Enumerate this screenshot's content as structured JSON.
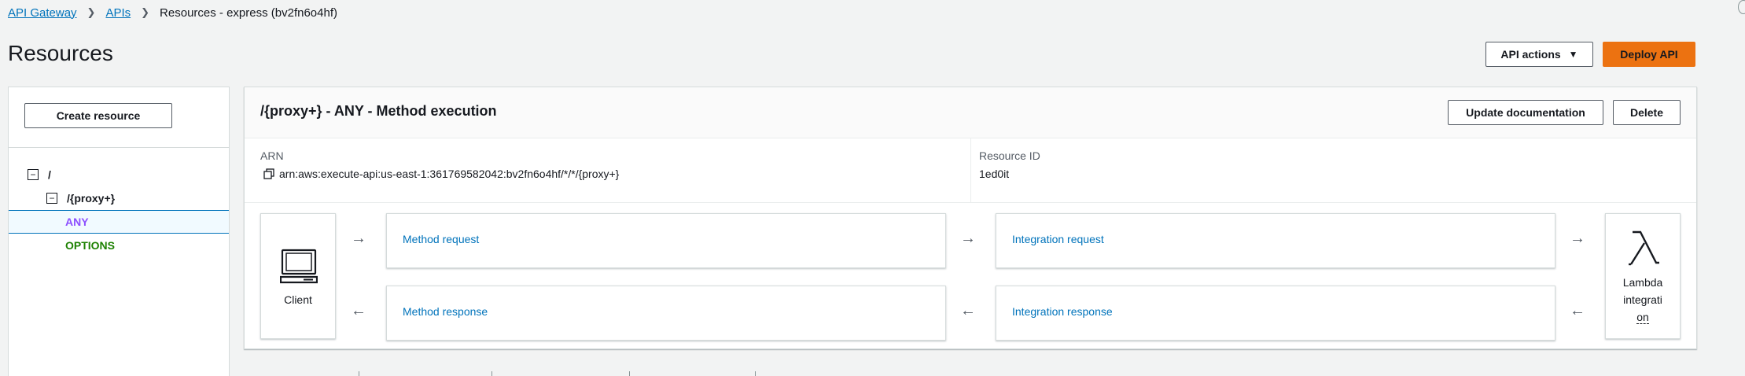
{
  "breadcrumb": {
    "items": [
      "API Gateway",
      "APIs"
    ],
    "current": "Resources - express (bv2fn6o4hf)"
  },
  "page": {
    "title": "Resources"
  },
  "header_actions": {
    "api_actions": "API actions",
    "deploy": "Deploy API"
  },
  "left_panel": {
    "create_resource": "Create resource",
    "tree": [
      {
        "path": "/",
        "toggle": "−"
      },
      {
        "path": "/{proxy+}",
        "toggle": "−"
      }
    ],
    "methods": [
      "ANY",
      "OPTIONS"
    ],
    "selected_method": "ANY"
  },
  "main_panel": {
    "title": "/{proxy+} - ANY - Method execution",
    "update_doc": "Update documentation",
    "delete": "Delete",
    "arn_label": "ARN",
    "arn_value": "arn:aws:execute-api:us-east-1:361769582042:bv2fn6o4hf/*/*/{proxy+}",
    "resource_id_label": "Resource ID",
    "resource_id_value": "1ed0it"
  },
  "flow": {
    "client_label": "Client",
    "method_request": "Method request",
    "method_response": "Method response",
    "integration_request": "Integration request",
    "integration_response": "Integration response",
    "lambda_line1": "Lambda",
    "lambda_line2": "integrati",
    "lambda_line3": "on",
    "arrow_right": "→",
    "arrow_left": "←"
  },
  "colors": {
    "link": "#0073bb",
    "primary_button": "#ec7211",
    "method_any": "#8c4fff",
    "method_options": "#1d8102"
  },
  "icons": [
    "copy-icon",
    "laptop-icon",
    "lambda-icon",
    "caret-down-icon",
    "chevron-right-icon"
  ]
}
